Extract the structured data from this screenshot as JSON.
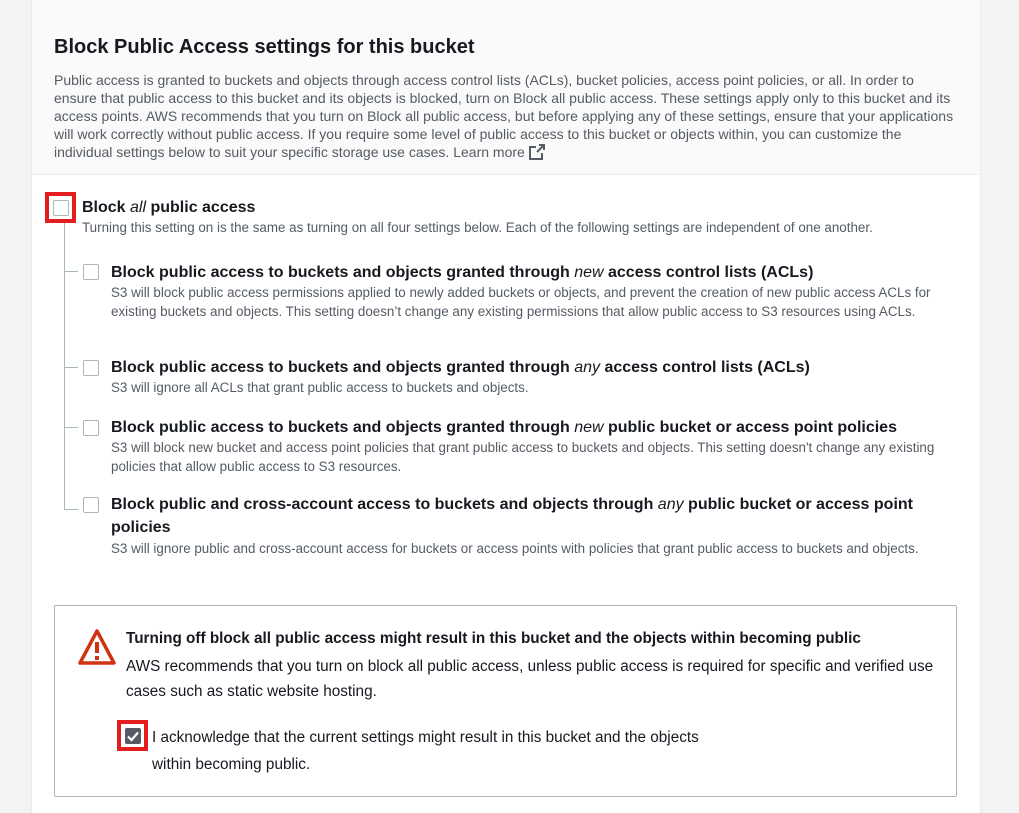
{
  "header": {
    "title": "Block Public Access settings for this bucket",
    "description": "Public access is granted to buckets and objects through access control lists (ACLs), bucket policies, access point policies, or all. In order to ensure that public access to this bucket and its objects is blocked, turn on Block all public access. These settings apply only to this bucket and its access points. AWS recommends that you turn on Block all public access, but before applying any of these settings, ensure that your applications will work correctly without public access. If you require some level of public access to this bucket or objects within, you can customize the individual settings below to suit your specific storage use cases.",
    "learn_more": "Learn more",
    "external_icon": "external-link-icon"
  },
  "block_all": {
    "title_pre": "Block ",
    "title_em": "all",
    "title_post": " public access",
    "description": "Turning this setting on is the same as turning on all four settings below. Each of the following settings are independent of one another.",
    "checked": false
  },
  "options": [
    {
      "title_pre": "Block public access to buckets and objects granted through ",
      "title_em": "new",
      "title_post": " access control lists (ACLs)",
      "description": "S3 will block public access permissions applied to newly added buckets or objects, and prevent the creation of new public access ACLs for existing buckets and objects. This setting doesn’t change any existing permissions that allow public access to S3 resources using ACLs.",
      "checked": false
    },
    {
      "title_pre": "Block public access to buckets and objects granted through ",
      "title_em": "any",
      "title_post": " access control lists (ACLs)",
      "description": "S3 will ignore all ACLs that grant public access to buckets and objects.",
      "checked": false
    },
    {
      "title_pre": "Block public access to buckets and objects granted through ",
      "title_em": "new",
      "title_post": " public bucket or access point policies",
      "description": "S3 will block new bucket and access point policies that grant public access to buckets and objects. This setting doesn't change any existing policies that allow public access to S3 resources.",
      "checked": false
    },
    {
      "title_pre": "Block public and cross-account access to buckets and objects through ",
      "title_em": "any",
      "title_post": " public bucket or access point policies",
      "description": "S3 will ignore public and cross-account access for buckets or access points with policies that grant public access to buckets and objects.",
      "checked": false
    }
  ],
  "warning": {
    "icon": "warning-icon",
    "title": "Turning off block all public access might result in this bucket and the objects within becoming public",
    "description": "AWS recommends that you turn on block all public access, unless public access is required for specific and verified use cases such as static website hosting.",
    "acknowledge": "I acknowledge that the current settings might result in this bucket and the objects within becoming public.",
    "acknowledge_checked": true
  },
  "colors": {
    "highlight": "#e31d1d",
    "warning_red": "#d13212",
    "text": "#16191f",
    "muted": "#545b64"
  }
}
